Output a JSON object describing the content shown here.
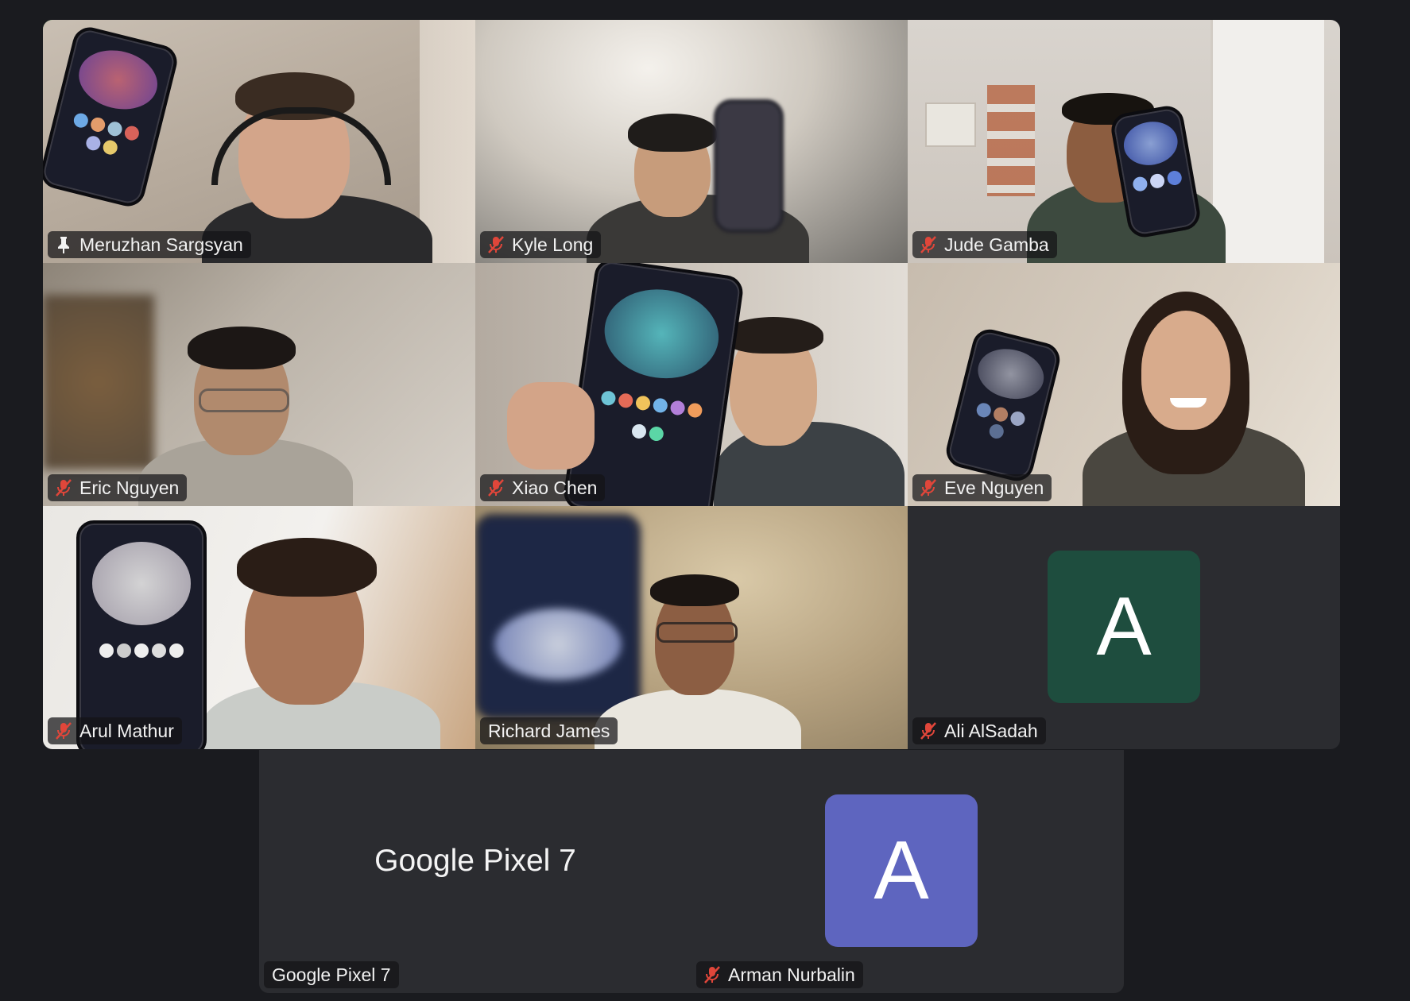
{
  "meeting": {
    "participants": [
      {
        "name": "Meruzhan Sargsyan",
        "status_icon": "pin-icon",
        "pinned": true,
        "active_speaker": true,
        "video": true
      },
      {
        "name": "Kyle Long",
        "status_icon": "mic-muted-icon",
        "video": true
      },
      {
        "name": "Jude Gamba",
        "status_icon": "mic-muted-icon",
        "video": true
      },
      {
        "name": "Eric Nguyen",
        "status_icon": "mic-muted-icon",
        "video": true
      },
      {
        "name": "Xiao Chen",
        "status_icon": "mic-muted-icon",
        "video": true
      },
      {
        "name": "Eve Nguyen",
        "status_icon": "mic-muted-icon",
        "video": true
      },
      {
        "name": "Arul Mathur",
        "status_icon": "mic-muted-icon",
        "video": true
      },
      {
        "name": "Richard James",
        "status_icon": "",
        "video": true
      },
      {
        "name": "Ali AlSadah",
        "status_icon": "mic-muted-icon",
        "video": false,
        "avatar_letter": "A",
        "avatar_color": "#1e4d3e"
      }
    ],
    "bottom_tiles": [
      {
        "name": "Google Pixel 7",
        "display_text": "Google Pixel 7",
        "status_icon": "",
        "video": false
      },
      {
        "name": "Arman Nurbalin",
        "status_icon": "mic-muted-icon",
        "video": false,
        "avatar_letter": "A",
        "avatar_color": "#5e65bf"
      }
    ]
  },
  "colors": {
    "background": "#1a1b1f",
    "tile_background": "#2b2c30",
    "active_speaker_border": "#5ed16a",
    "muted_icon": "#e0463a",
    "name_text": "#f2f2f2"
  }
}
